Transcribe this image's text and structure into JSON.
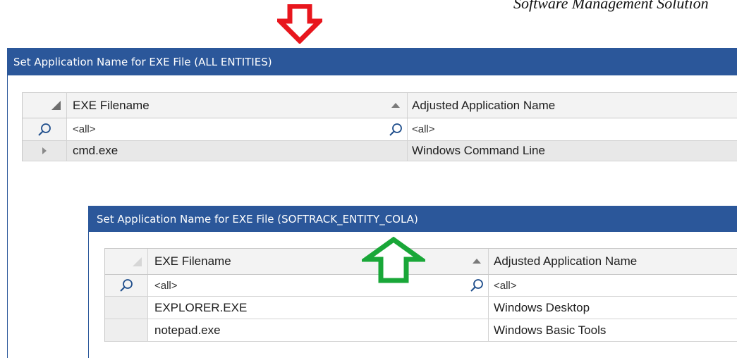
{
  "doc_header": "Software Management Solution",
  "colors": {
    "titlebar": "#2b579a",
    "red_arrow": "#e8161d",
    "green_arrow": "#19a738"
  },
  "window_all": {
    "title": "Set Application Name for EXE File (ALL ENTITIES)",
    "columns": [
      "EXE Filename",
      "Adjusted Application Name"
    ],
    "filter": [
      "<all>",
      "<all>"
    ],
    "rows": [
      {
        "exe": "cmd.exe",
        "app": "Windows Command Line"
      }
    ]
  },
  "window_entity": {
    "title": "Set Application Name for EXE File (SOFTRACK_ENTITY_COLA)",
    "columns": [
      "EXE Filename",
      "Adjusted Application Name"
    ],
    "filter": [
      "<all>",
      "<all>"
    ],
    "rows": [
      {
        "exe": "EXPLORER.EXE",
        "app": "Windows Desktop"
      },
      {
        "exe": "notepad.exe",
        "app": "Windows Basic Tools"
      }
    ]
  },
  "icons": {
    "filter_row_icon": "magnifier-icon",
    "sort_icon": "sort-ascending-icon",
    "row_indicator": "current-row-indicator-icon",
    "annotation_down": "red-down-arrow-icon",
    "annotation_up": "green-up-arrow-icon"
  }
}
